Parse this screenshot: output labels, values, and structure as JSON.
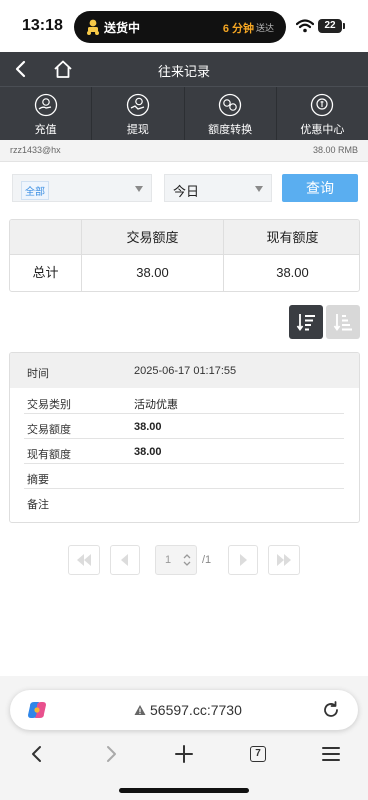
{
  "status_bar": {
    "time": "13:18",
    "activity_label": "送货中",
    "eta": "6 分钟",
    "eta_suffix": "送达",
    "battery": "22"
  },
  "header": {
    "title": "往来记录"
  },
  "menu": {
    "items": [
      {
        "label": "充值",
        "icon": "deposit-icon"
      },
      {
        "label": "提现",
        "icon": "withdraw-icon"
      },
      {
        "label": "额度转换",
        "icon": "transfer-icon"
      },
      {
        "label": "优惠中心",
        "icon": "promo-icon"
      }
    ]
  },
  "account": {
    "username": "rzz1433@hx",
    "balance": "38.00 RMB"
  },
  "filter": {
    "type_selected": "全部",
    "date_selected": "今日",
    "query_label": "查询"
  },
  "summary": {
    "headers": [
      "",
      "交易额度",
      "现有额度"
    ],
    "row": {
      "label": "总计",
      "trade_amount": "38.00",
      "current_amount": "38.00"
    }
  },
  "detail": {
    "time_label": "时间",
    "time_value": "2025-06-17 01:17:55",
    "rows": [
      {
        "label": "交易类别",
        "value": "活动优惠"
      },
      {
        "label": "交易额度",
        "value": "38.00"
      },
      {
        "label": "现有额度",
        "value": "38.00"
      },
      {
        "label": "摘要",
        "value": ""
      },
      {
        "label": "备注",
        "value": ""
      }
    ]
  },
  "pagination": {
    "current_page": "1",
    "total": "/1"
  },
  "browser": {
    "url": "56597.cc:7730",
    "tab_count": "7"
  },
  "colors": {
    "header_bg": "#3a3d42",
    "accent_blue": "#5aaef0",
    "eta_orange": "#f5a623"
  }
}
